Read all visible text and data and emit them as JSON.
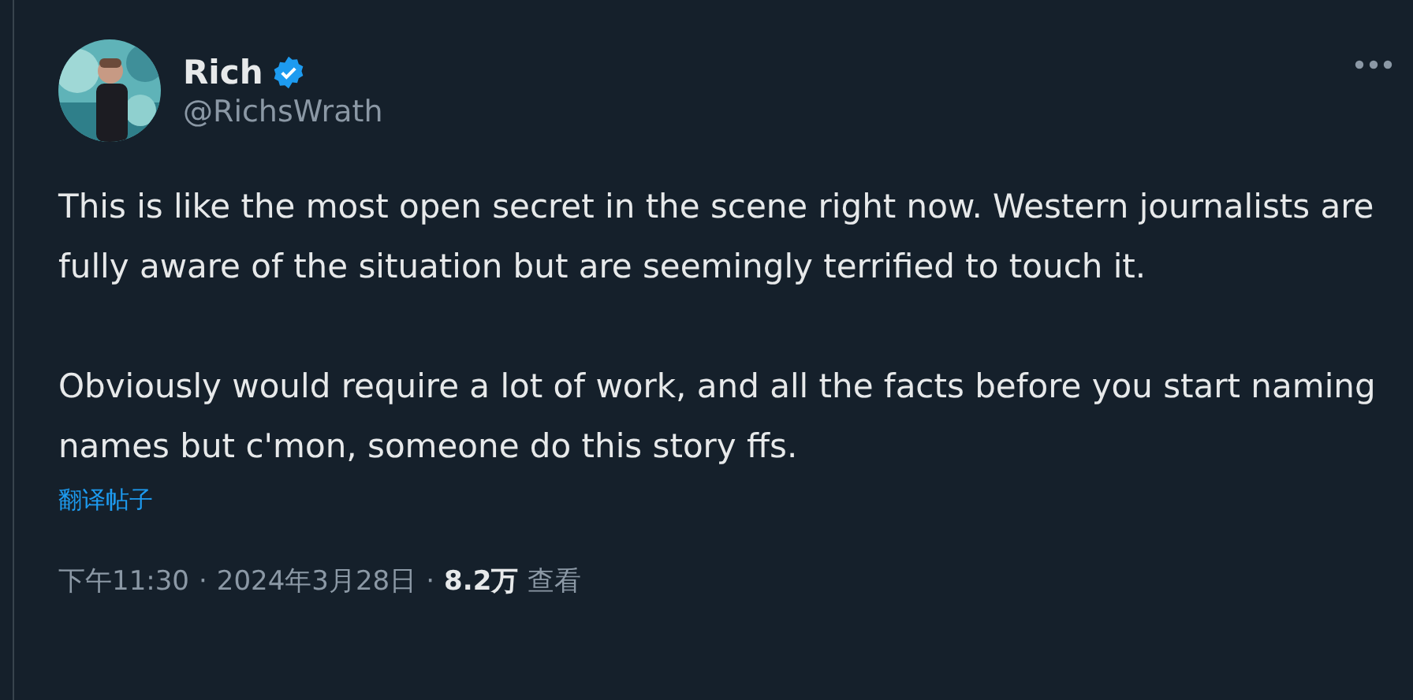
{
  "author": {
    "name": "Rich",
    "verified": true,
    "handle": "@RichsWrath"
  },
  "paragraphs": [
    "This is like the most open secret in the scene right now. Western journalists are fully aware of the situation but are seemingly terrified to touch it.",
    "Obviously would require a lot of work, and all the facts before you start naming names but c'mon, someone do this story ffs."
  ],
  "translate_link": "翻译帖子",
  "meta": {
    "time": "下午11:30",
    "separator_1": "·",
    "date": "2024年3月28日",
    "separator_2": "·",
    "views": "8.2万",
    "views_label": "查看"
  }
}
